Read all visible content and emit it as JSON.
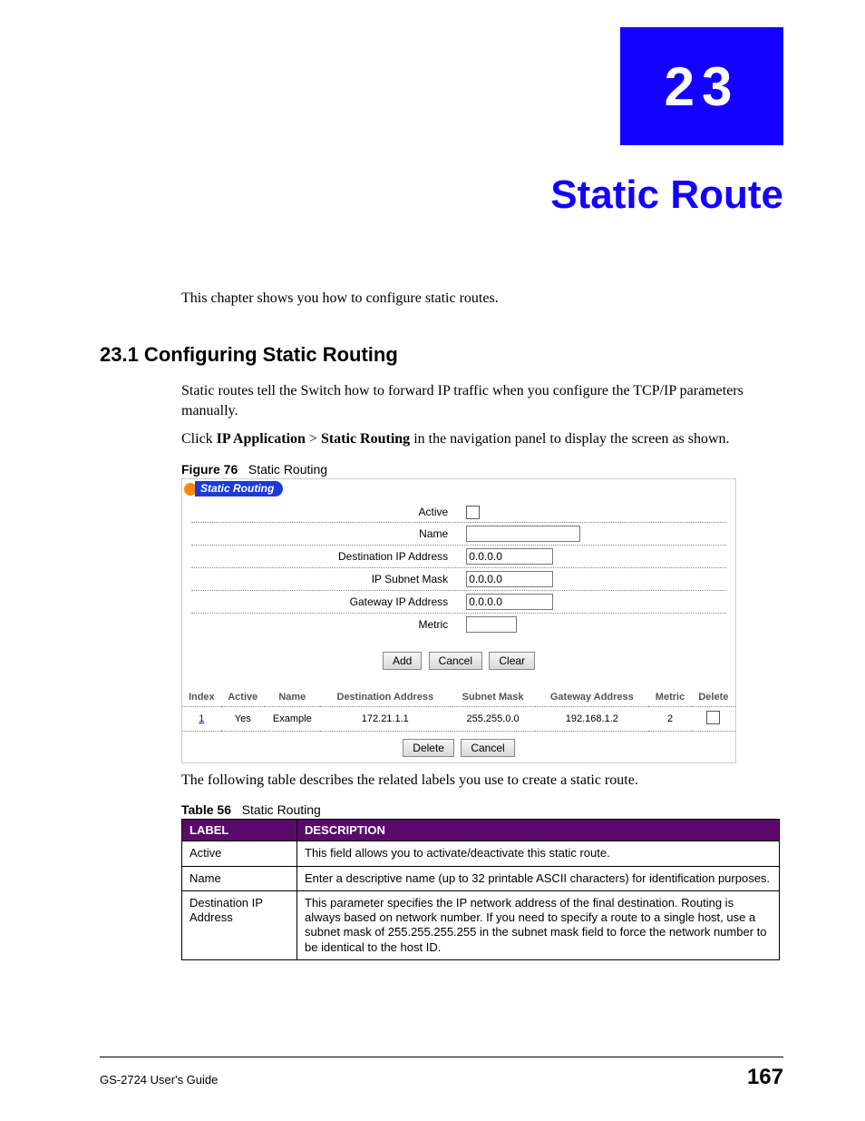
{
  "chapter": {
    "number": "23",
    "title": "Static Route"
  },
  "intro": "This chapter shows you how to configure static routes.",
  "section": {
    "heading": "23.1  Configuring Static Routing",
    "p1": "Static routes tell the Switch how to forward IP traffic when you configure the TCP/IP parameters manually.",
    "p2_pre": "Click ",
    "p2_b1": "IP Application",
    "p2_mid": " > ",
    "p2_b2": "Static Routing",
    "p2_post": " in the navigation panel to display the screen as shown."
  },
  "figure": {
    "caption_label": "Figure 76",
    "caption_text": "Static Routing",
    "panel_title": "Static Routing",
    "fields": {
      "active": "Active",
      "name": "Name",
      "dest": "Destination IP Address",
      "mask": "IP Subnet Mask",
      "gw": "Gateway IP Address",
      "metric": "Metric"
    },
    "values": {
      "dest": "0.0.0.0",
      "mask": "0.0.0.0",
      "gw": "0.0.0.0",
      "name": "",
      "metric": ""
    },
    "buttons": {
      "add": "Add",
      "cancel": "Cancel",
      "clear": "Clear",
      "delete": "Delete",
      "cancel2": "Cancel"
    },
    "list": {
      "headers": {
        "index": "Index",
        "active": "Active",
        "name": "Name",
        "dest": "Destination Address",
        "mask": "Subnet Mask",
        "gw": "Gateway Address",
        "metric": "Metric",
        "delete": "Delete"
      },
      "row": {
        "index": "1",
        "active": "Yes",
        "name": "Example",
        "dest": "172.21.1.1",
        "mask": "255.255.0.0",
        "gw": "192.168.1.2",
        "metric": "2"
      }
    }
  },
  "after_figure": "The following table describes the related labels you use to create a static route.",
  "table": {
    "caption_label": "Table 56",
    "caption_text": "Static Routing",
    "headers": {
      "label": "LABEL",
      "desc": "DESCRIPTION"
    },
    "rows": [
      {
        "label": "Active",
        "desc": "This field allows you to activate/deactivate this static route."
      },
      {
        "label": "Name",
        "desc": "Enter a descriptive name (up to 32 printable ASCII characters) for identification purposes."
      },
      {
        "label": "Destination IP Address",
        "desc": "This parameter specifies the IP network address of the final destination. Routing is always based on network number. If you need to specify a route to a single host, use a subnet mask of 255.255.255.255 in the subnet mask field to force the network number to be identical to the host ID."
      }
    ]
  },
  "footer": {
    "left": "GS-2724 User's Guide",
    "right": "167"
  }
}
